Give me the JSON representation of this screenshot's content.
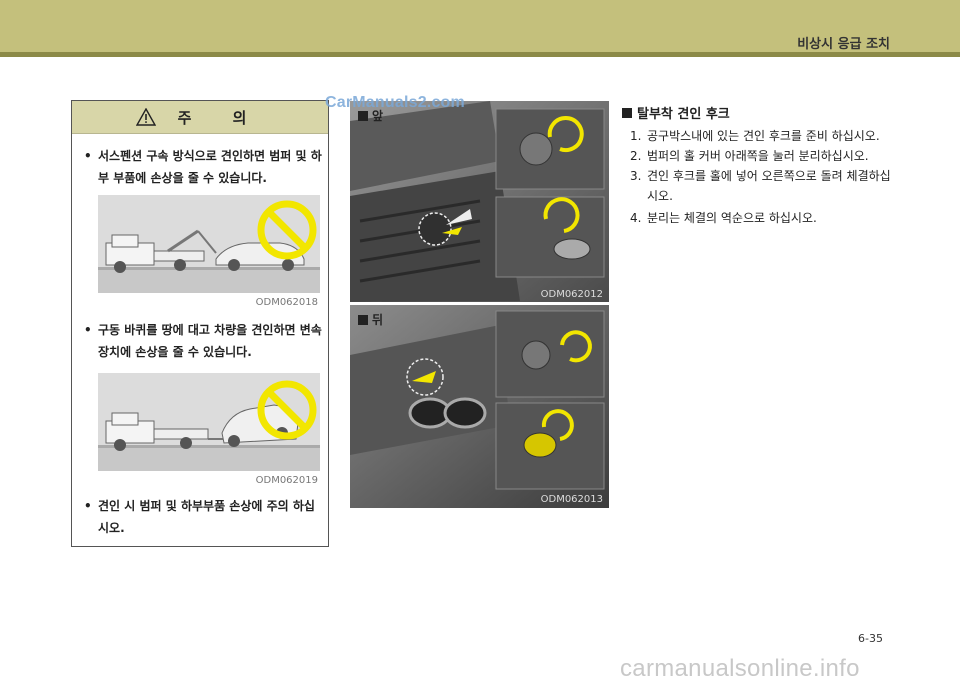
{
  "header": {
    "section_title": "비상시 응급 조치"
  },
  "watermarks": {
    "top": "CarManuals2.com",
    "bottom": "carmanualsonline.info"
  },
  "caution": {
    "title": "주 의",
    "bullets": [
      "서스펜션 구속 방식으로 견인하면 범퍼 및 하부 부품에 손상을 줄 수 있습니다.",
      "구동 바퀴를 땅에 대고 차량을 견인하면 변속장치에 손상을 줄 수 있습니다.",
      "견인 시 범퍼 및 하부부품 손상에 주의 하십시오."
    ],
    "figure_codes": [
      "ODM062018",
      "ODM062019"
    ]
  },
  "photos": {
    "front": {
      "label": "앞",
      "code": "ODM062012"
    },
    "rear": {
      "label": "뒤",
      "code": "ODM062013"
    }
  },
  "instructions": {
    "heading": "탈부착 견인 후크",
    "steps": [
      {
        "num": "1.",
        "text": "공구박스내에 있는 견인 후크를 준비 하십시오."
      },
      {
        "num": "2.",
        "text": "범퍼의 홀 커버 아래쪽을 눌러 분리하십시오."
      },
      {
        "num": "3.",
        "text": "견인 후크를 홀에 넣어 오른쪽으로 돌려 체결하십시오."
      },
      {
        "num": "4.",
        "text": "분리는 체결의 역순으로 하십시오."
      }
    ]
  },
  "page_number": "6-35",
  "icons": [
    "warning-triangle-icon",
    "prohibition-icon",
    "rotate-arrow-icon",
    "push-arrow-icon"
  ]
}
